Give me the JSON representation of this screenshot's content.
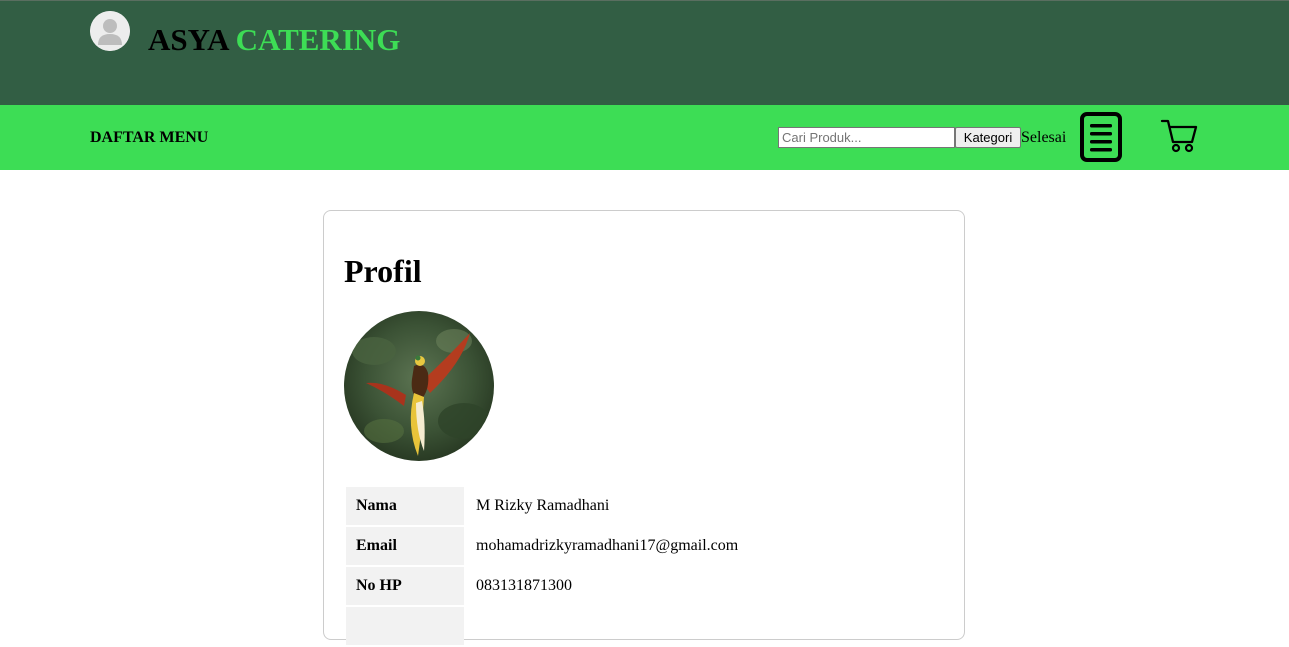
{
  "header": {
    "brand_part1": "ASYA",
    "brand_part2": "CATERING"
  },
  "nav": {
    "menu_label": "DAFTAR MENU",
    "search_placeholder": "Cari Produk...",
    "category_button": "Kategori",
    "done_label": "Selesai",
    "icons": [
      "user-avatar-icon",
      "order-list-icon",
      "shopping-cart-icon"
    ]
  },
  "profile": {
    "title": "Profil",
    "rows": [
      {
        "label": "Nama",
        "value": "M Rizky Ramadhani"
      },
      {
        "label": "Email",
        "value": "mohamadrizkyramadhani17@gmail.com"
      },
      {
        "label": "No HP",
        "value": "083131871300"
      },
      {
        "label": "",
        "value": ""
      }
    ]
  },
  "colors": {
    "header_bg": "#325e44",
    "nav_bg": "#3ddd55",
    "brand_accent": "#3ddd55"
  }
}
